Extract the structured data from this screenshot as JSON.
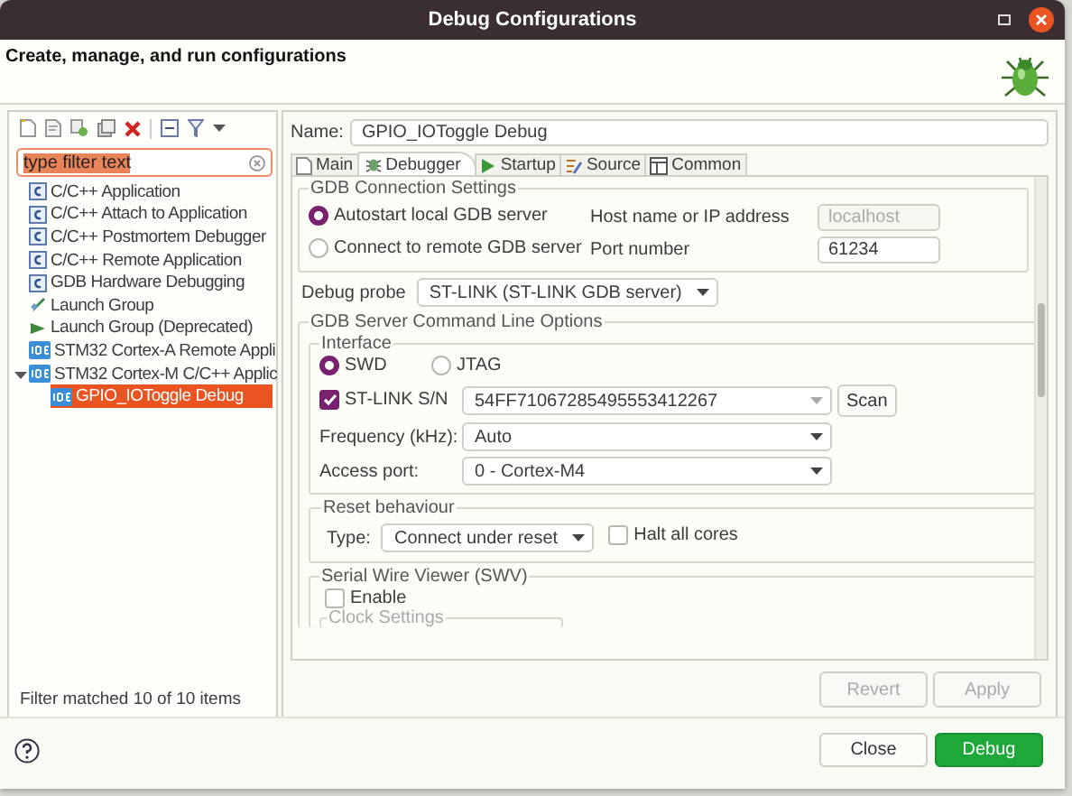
{
  "window": {
    "title": "Debug Configurations"
  },
  "header": {
    "message": "Create, manage, and run configurations"
  },
  "filter": {
    "value": "type filter text"
  },
  "tree": [
    {
      "label": "C/C++ Application",
      "kind": "c",
      "selected": false
    },
    {
      "label": "C/C++ Attach to Application",
      "kind": "c",
      "selected": false
    },
    {
      "label": "C/C++ Postmortem Debugger",
      "kind": "c",
      "selected": false
    },
    {
      "label": "C/C++ Remote Application",
      "kind": "c",
      "selected": false
    },
    {
      "label": "GDB Hardware Debugging",
      "kind": "c",
      "selected": false
    },
    {
      "label": "Launch Group",
      "kind": "launch_group",
      "selected": false
    },
    {
      "label": "Launch Group (Deprecated)",
      "kind": "launch_group_deprecated",
      "selected": false
    },
    {
      "label": "STM32 Cortex-A Remote Appli",
      "kind": "ide",
      "selected": false
    },
    {
      "label": "STM32 Cortex-M C/C++ Applic",
      "kind": "ide",
      "selected": false,
      "expanded": true,
      "children": [
        {
          "label": "GPIO_IOToggle Debug",
          "kind": "ide",
          "selected": true
        }
      ]
    }
  ],
  "filter_status": "Filter matched 10 of 10 items",
  "config": {
    "name_label": "Name:",
    "name": "GPIO_IOToggle Debug"
  },
  "tabs": [
    {
      "label": "Main",
      "kind": "main",
      "selected": false
    },
    {
      "label": "Debugger",
      "kind": "debugger",
      "selected": true
    },
    {
      "label": "Startup",
      "kind": "startup",
      "selected": false
    },
    {
      "label": "Source",
      "kind": "source",
      "selected": false
    },
    {
      "label": "Common",
      "kind": "common",
      "selected": false
    }
  ],
  "gdb_connection": {
    "title": "GDB Connection Settings",
    "modes": [
      {
        "label": "Autostart local GDB server",
        "selected": true
      },
      {
        "label": "Connect to remote GDB server",
        "selected": false
      }
    ],
    "host": {
      "label": "Host name or IP address",
      "value": "localhost",
      "disabled": true
    },
    "port": {
      "label": "Port number",
      "value": "61234",
      "disabled": false
    }
  },
  "debug_probe": {
    "label": "Debug probe",
    "value": "ST-LINK (ST-LINK GDB server)"
  },
  "server_options": {
    "title": "GDB Server Command Line Options",
    "interface": {
      "title": "Interface",
      "protocols": [
        {
          "label": "SWD",
          "selected": true
        },
        {
          "label": "JTAG",
          "selected": false
        }
      ],
      "serial": {
        "label": "ST-LINK S/N",
        "checked": true,
        "value": "54FF71067285495553412267",
        "button": "Scan"
      },
      "frequency": {
        "label": "Frequency (kHz):",
        "value": "Auto"
      },
      "access_port": {
        "label": "Access port:",
        "value": "0 - Cortex-M4"
      }
    },
    "reset": {
      "title": "Reset behaviour",
      "type_label": "Type:",
      "type": "Connect under reset",
      "halt_all_cores": {
        "label": "Halt all cores",
        "checked": false
      }
    },
    "swv": {
      "title": "Serial Wire Viewer (SWV)",
      "enable": {
        "label": "Enable",
        "checked": false
      },
      "clock_title": "Clock Settings"
    }
  },
  "actions": [
    {
      "label": "Revert",
      "disabled": true
    },
    {
      "label": "Apply",
      "disabled": true
    }
  ],
  "footer_buttons": [
    {
      "label": "Close",
      "kind": "default"
    },
    {
      "label": "Debug",
      "kind": "primary"
    }
  ]
}
